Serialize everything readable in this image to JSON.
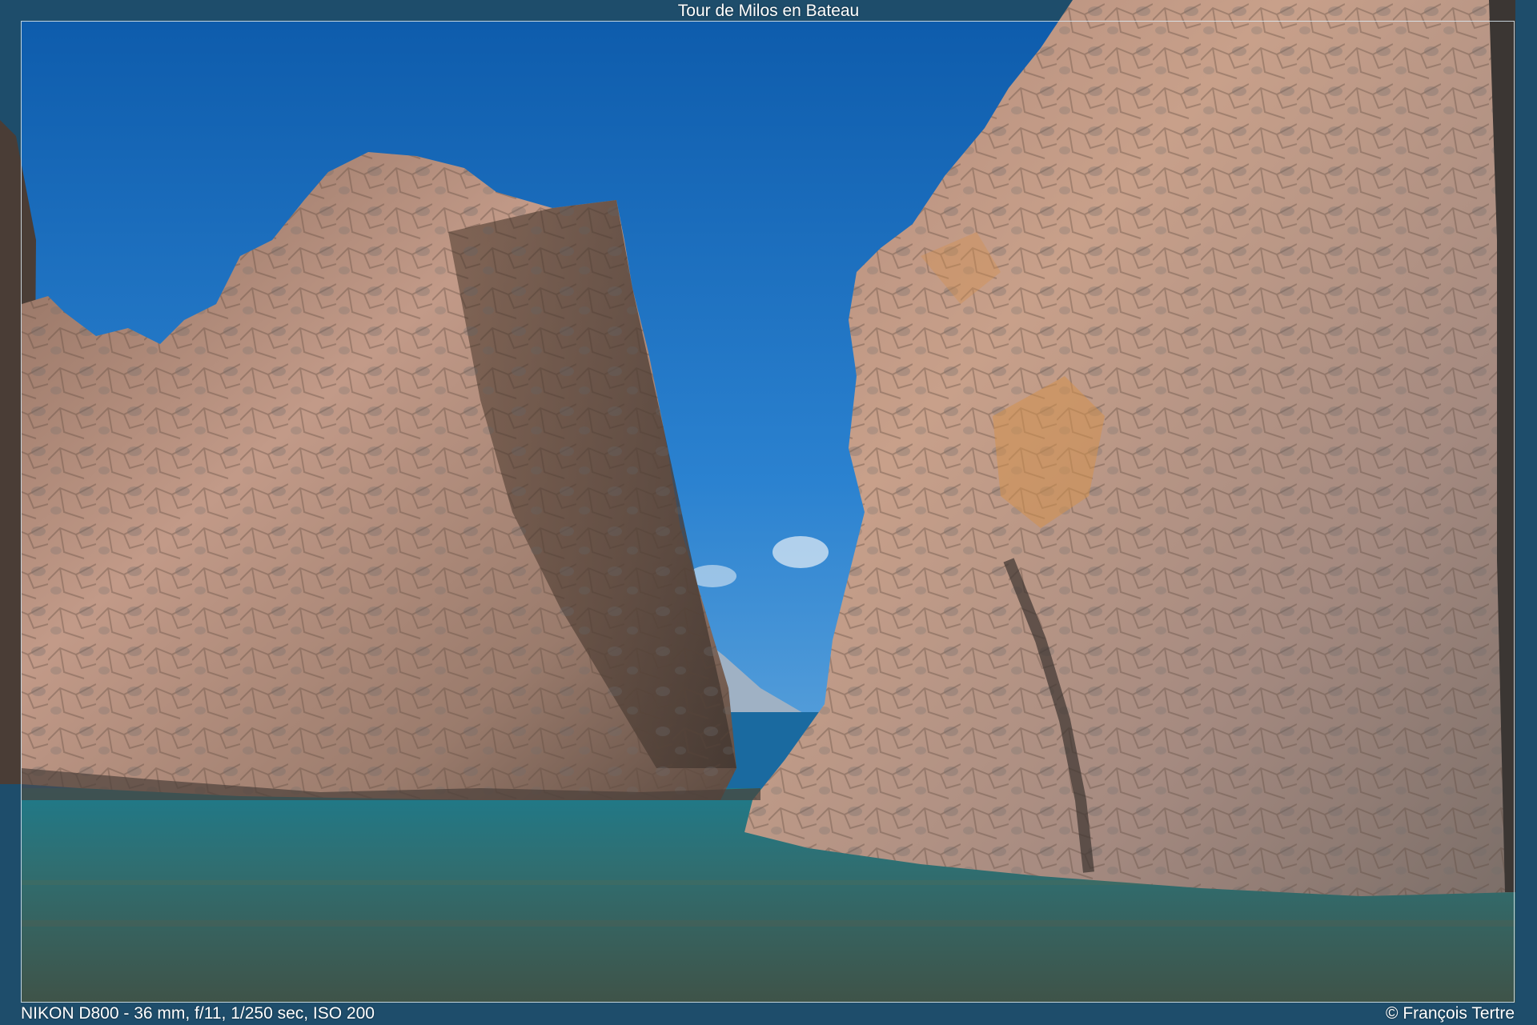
{
  "title": "Tour de Milos en Bateau",
  "caption": {
    "camera_info": "NIKON D800 - 36 mm, f/11, 1/250 sec, ISO 200",
    "copyright": "© François Tertre"
  },
  "colors": {
    "frame_background": "#1e4d6b",
    "sky": "#1f73c4",
    "sea": "#1b5f6e",
    "rock": "#b88f7a"
  }
}
